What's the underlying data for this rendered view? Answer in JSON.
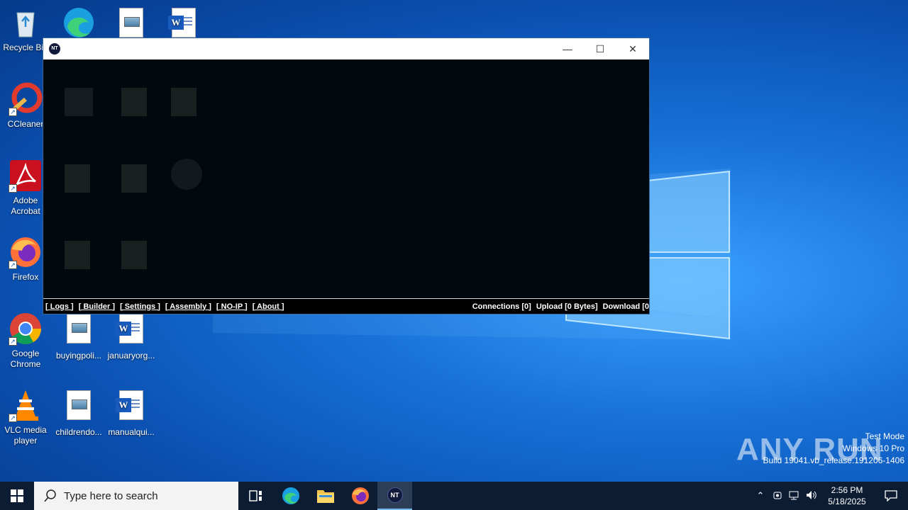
{
  "desktop": {
    "icons": [
      {
        "label": "Recycle Bin"
      },
      {
        "label": "CCleaner"
      },
      {
        "label": "Adobe Acrobat"
      },
      {
        "label": "Firefox"
      },
      {
        "label": "Google Chrome"
      },
      {
        "label": "VLC media player"
      },
      {
        "label": "buyingpoli..."
      },
      {
        "label": "januaryorg..."
      },
      {
        "label": "childrendo..."
      },
      {
        "label": "manualqui..."
      }
    ]
  },
  "window": {
    "app_icon_text": "NT",
    "controls": {
      "minimize": "—",
      "maximize": "☐",
      "close": "✕"
    },
    "menu": {
      "logs": "[ Logs ]",
      "builder": "[ Builder ]",
      "settings": "[ Settings ]",
      "assembly": "[ Assembly ]",
      "noip": "[ NO-IP ]",
      "about": "[ About ]"
    },
    "stats": {
      "connections": "Connections [0]",
      "upload": "Upload [0 Bytes]",
      "download": "Download [0"
    }
  },
  "watermark": {
    "brand": "ANY RUN",
    "line1": "Test Mode",
    "line2": "Windows 10 Pro",
    "line3": "Build 19041.vb_release.191206-1406"
  },
  "taskbar": {
    "search_placeholder": "Type here to search",
    "time": "2:56 PM",
    "date": "5/18/2025",
    "active_app_text": "NT"
  },
  "colors": {
    "desktop_blue": "#0a5fc8",
    "taskbar": "#0c1d33",
    "console_bg": "#02090e",
    "word_blue": "#185abd"
  }
}
